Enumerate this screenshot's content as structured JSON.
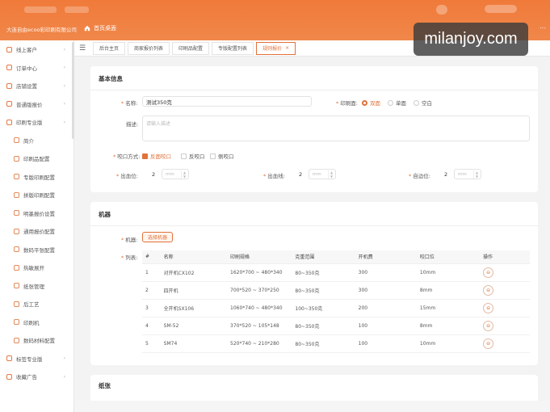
{
  "topbar": {
    "company": "大连自由ecoo彩印刷有限公司",
    "home": "首页桌面"
  },
  "watermark": "milanjoy.com",
  "sidebar": {
    "items": [
      {
        "label": "线上客户",
        "sub": false
      },
      {
        "label": "订单中心",
        "sub": false
      },
      {
        "label": "店铺设置",
        "sub": false
      },
      {
        "label": "普通版报价",
        "sub": false
      },
      {
        "label": "印刷专业版",
        "sub": false
      },
      {
        "label": "简介",
        "sub": true
      },
      {
        "label": "印刷品配置",
        "sub": true
      },
      {
        "label": "专版印刷配置",
        "sub": true
      },
      {
        "label": "拼版印刷配置",
        "sub": true
      },
      {
        "label": "明墨报价设置",
        "sub": true
      },
      {
        "label": "通用报价配置",
        "sub": true
      },
      {
        "label": "数码平张配置",
        "sub": true
      },
      {
        "label": "热敏展开",
        "sub": true
      },
      {
        "label": "纸张管理",
        "sub": true
      },
      {
        "label": "后工艺",
        "sub": true
      },
      {
        "label": "印刷机",
        "sub": true
      },
      {
        "label": "数码材料配置",
        "sub": true
      },
      {
        "label": "标签专业版",
        "sub": false
      },
      {
        "label": "收藏广告",
        "sub": false
      }
    ]
  },
  "tabs": [
    {
      "label": "后台主页",
      "active": false
    },
    {
      "label": "商家报价列表",
      "active": false
    },
    {
      "label": "印刷品配置",
      "active": false
    },
    {
      "label": "专版配置列表",
      "active": false
    },
    {
      "label": "规则报价",
      "active": true
    }
  ],
  "basic": {
    "title": "基本信息",
    "name_label": "名称:",
    "name_value": "测试350克",
    "print_side_label": "印刷面:",
    "print_side_options": [
      "双面",
      "单面",
      "空白"
    ],
    "print_side_selected": 0,
    "desc_label": "描述:",
    "desc_placeholder": "请输入描述",
    "bite_label": "咬口方式:",
    "bite_options": [
      "反面咬口",
      "反咬口",
      "侧咬口"
    ],
    "bite_checked": 0,
    "bleed_label": "出血位:",
    "bleed_value": "2",
    "trim_label": "出血线:",
    "trim_value": "2",
    "self_label": "自边位:",
    "self_value": "2",
    "unit": "mm"
  },
  "machine": {
    "title": "机器",
    "machine_label": "机器:",
    "select_button": "选择机器",
    "list_label": "列表:",
    "columns": [
      "#",
      "名称",
      "印刷规格",
      "克重范围",
      "开机费",
      "咬口位",
      "操作"
    ],
    "rows": [
      [
        "1",
        "对开机CX102",
        "1620*700 ~ 480*340",
        "80~350克",
        "300",
        "10mm"
      ],
      [
        "2",
        "四开机",
        "700*520 ~ 370*250",
        "80~350克",
        "300",
        "8mm"
      ],
      [
        "3",
        "全开机SX106",
        "1060*740 ~ 480*340",
        "100~350克",
        "200",
        "15mm"
      ],
      [
        "4",
        "SM-52",
        "370*520 ~ 105*148",
        "80~350克",
        "100",
        "8mm"
      ],
      [
        "5",
        "SM74",
        "520*740 ~ 210*280",
        "80~350克",
        "100",
        "10mm"
      ]
    ]
  },
  "paper": {
    "title": "纸张"
  }
}
